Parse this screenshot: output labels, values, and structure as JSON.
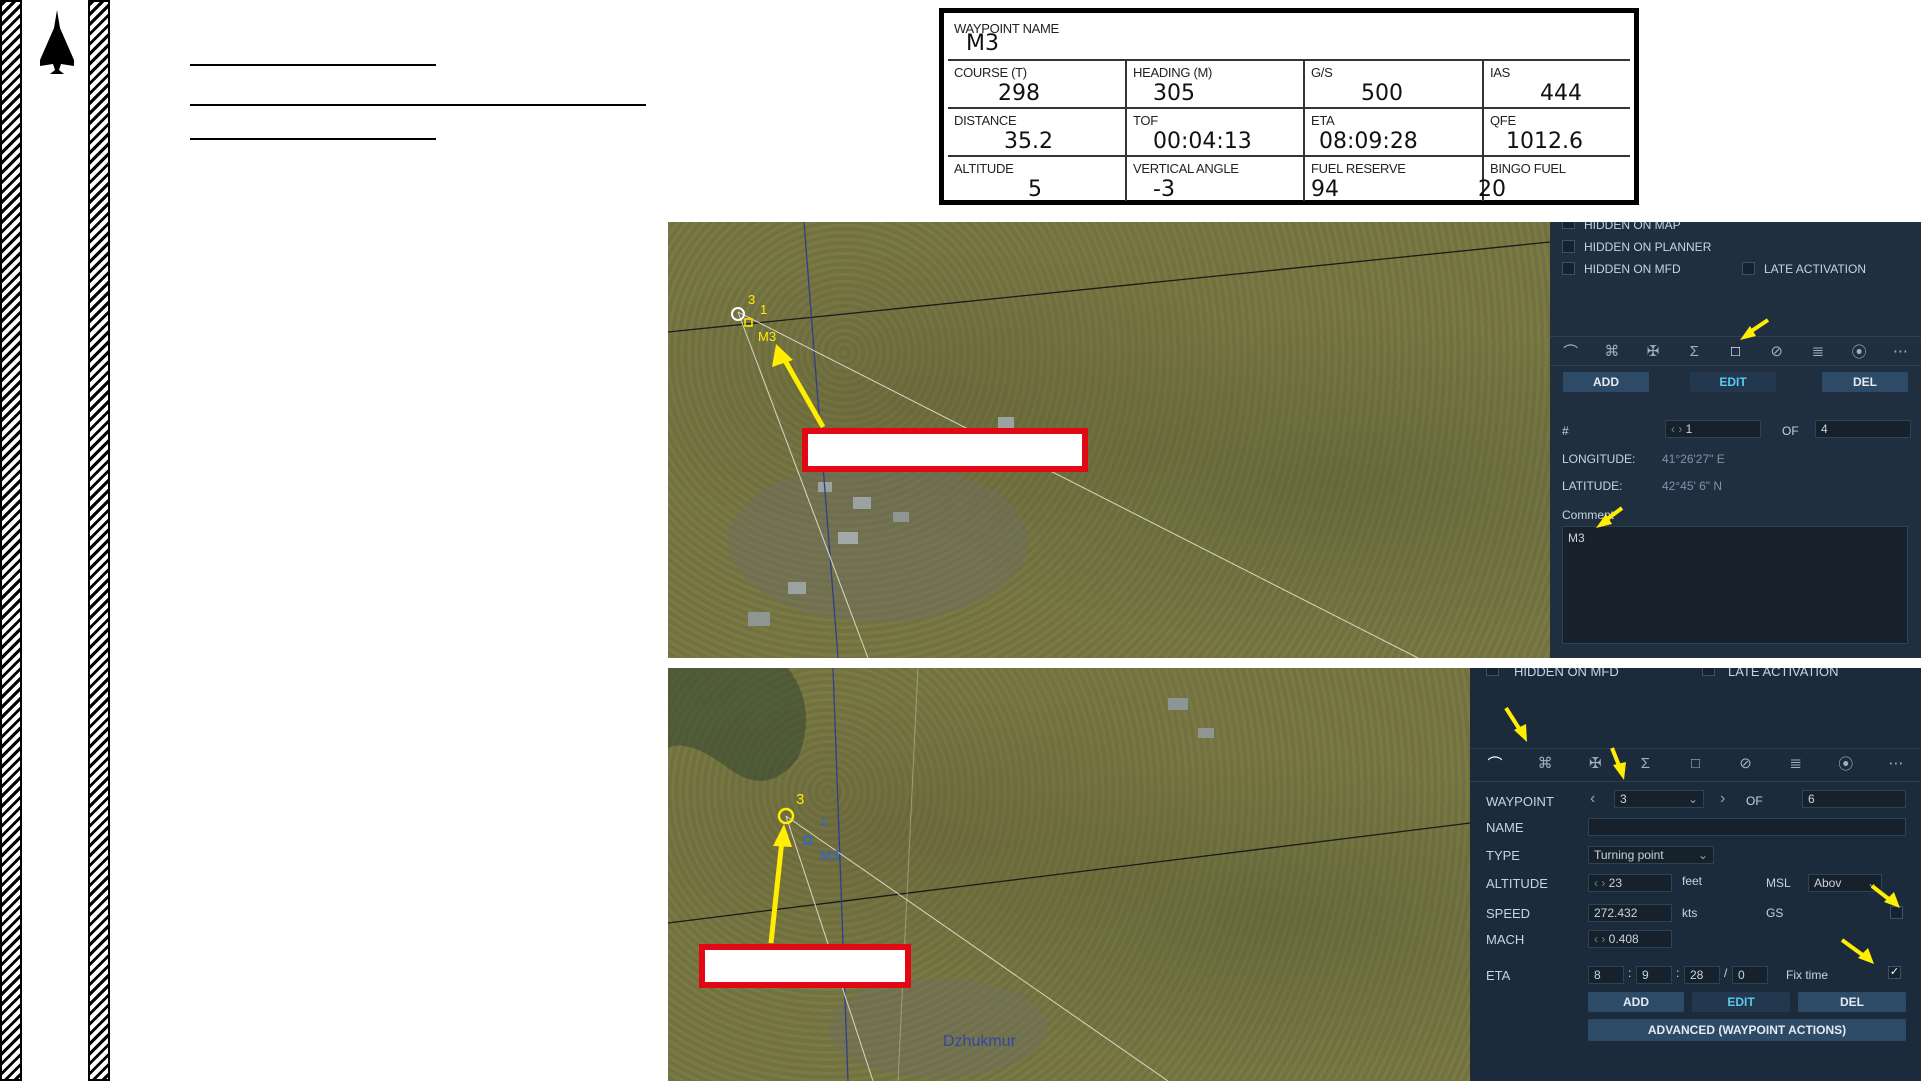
{
  "sidebar": {
    "logo_icon": "fighter-jet-icon"
  },
  "data_card": {
    "rows": [
      [
        {
          "label": "WAYPOINT NAME",
          "value": "M3"
        }
      ],
      [
        {
          "label": "COURSE (T)",
          "value": "298"
        },
        {
          "label": "HEADING (M)",
          "value": "305"
        },
        {
          "label": "G/S",
          "value": "500"
        },
        {
          "label": "IAS",
          "value": "444"
        }
      ],
      [
        {
          "label": "DISTANCE",
          "value": "35.2"
        },
        {
          "label": "TOF",
          "value": "00:04:13"
        },
        {
          "label": "ETA",
          "value": "08:09:28"
        },
        {
          "label": "QFE",
          "value": "1012.6"
        }
      ],
      [
        {
          "label": "ALTITUDE",
          "value": "5"
        },
        {
          "label": "VERTICAL ANGLE",
          "value": "-3"
        },
        {
          "label": "FUEL RESERVE",
          "value": "94"
        },
        {
          "label": "BINGO FUEL",
          "value": "20"
        }
      ]
    ]
  },
  "map_top": {
    "waypoint_number": "3",
    "waypoint_index": "1",
    "waypoint_name": "M3"
  },
  "panel_top": {
    "hidden_on_map": "HIDDEN ON MAP",
    "hidden_on_planner": "HIDDEN ON PLANNER",
    "hidden_on_mfd": "HIDDEN ON MFD",
    "late_activation": "LATE ACTIVATION",
    "add": "ADD",
    "edit": "EDIT",
    "del": "DEL",
    "number_label": "#",
    "number_value": "1",
    "of_label": "OF",
    "of_value": "4",
    "longitude_label": "LONGITUDE:",
    "longitude_value": "41°26'27\" E",
    "latitude_label": "LATITUDE:",
    "latitude_value": "42°45' 6\" N",
    "comment_label": "Comment",
    "comment_value": "M3"
  },
  "map_bottom": {
    "waypoint_number": "3",
    "waypoint_index": "1",
    "waypoint_name": "M3",
    "town_name": "Dzhukmur"
  },
  "panel_bottom": {
    "hidden_on_mfd": "HIDDEN ON MFD",
    "late_activation": "LATE ACTIVATION",
    "waypoint_label": "WAYPOINT",
    "waypoint_value": "3",
    "of_label": "OF",
    "of_value": "6",
    "name_label": "NAME",
    "name_value": "",
    "type_label": "TYPE",
    "type_value": "Turning point",
    "altitude_label": "ALTITUDE",
    "altitude_value": "23",
    "altitude_unit": "feet",
    "altitude_ref": "MSL",
    "altitude_mode": "Abov",
    "speed_label": "SPEED",
    "speed_value": "272.432",
    "speed_unit": "kts",
    "gs_label": "GS",
    "mach_label": "MACH",
    "mach_value": "0.408",
    "eta_label": "ETA",
    "eta_h": "8",
    "eta_m": "9",
    "eta_s": "28",
    "eta_d": "0",
    "fix_time_label": "Fix time",
    "fix_time_checked": true,
    "add": "ADD",
    "edit": "EDIT",
    "del": "DEL",
    "advanced": "ADVANCED (WAYPOINT ACTIONS)"
  },
  "colors": {
    "annotation_arrow": "#ffee00",
    "highlight_box": "#e30613",
    "panel_bg": "#1f2f40",
    "edit_active": "#5cc8f0"
  }
}
